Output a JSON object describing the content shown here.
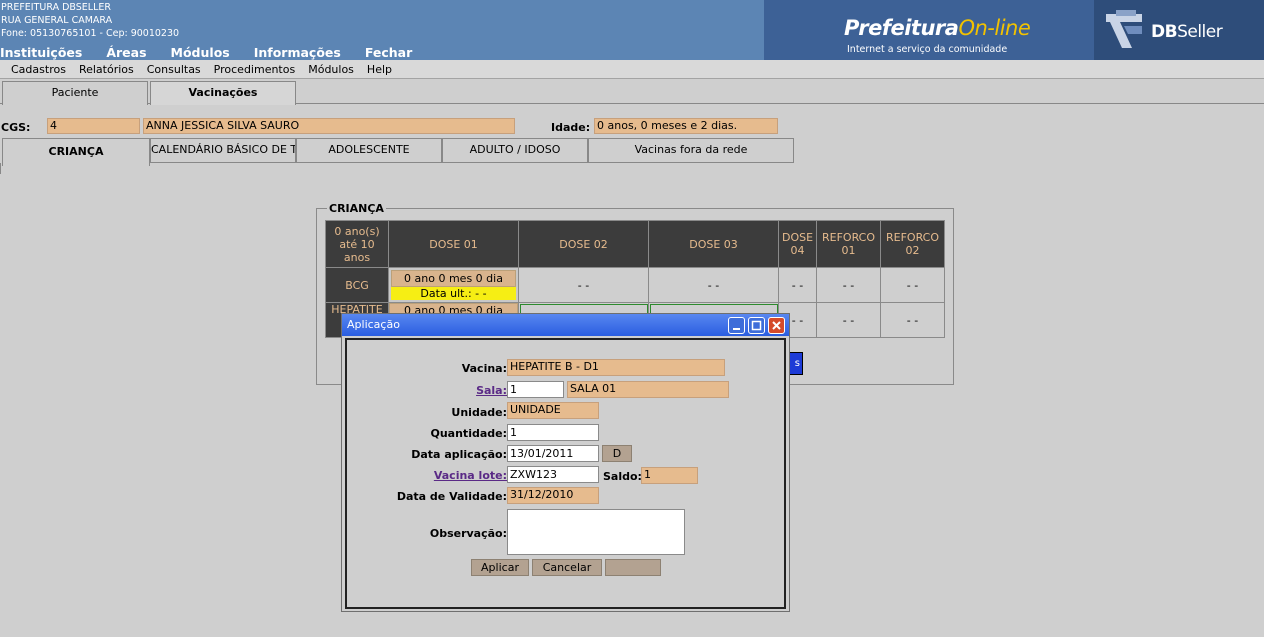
{
  "header": {
    "org_name": "PREFEITURA DBSELLER",
    "org_address": "RUA GENERAL CAMARA",
    "org_contact": "Fone: 05130765101  -  Cep: 90010230",
    "menu": [
      "Instituições",
      "Áreas",
      "Módulos",
      "Informações",
      "Fechar"
    ],
    "brand_main": "Prefeitura",
    "brand_online": "On-line",
    "brand_tagline": "Internet a serviço da comunidade",
    "dbseller_bold": "DB",
    "dbseller_rest": "Seller"
  },
  "submenu": [
    "Cadastros",
    "Relatórios",
    "Consultas",
    "Procedimentos",
    "Módulos",
    "Help"
  ],
  "tabs": {
    "paciente": "Paciente",
    "vacinacoes": "Vacinações"
  },
  "patient": {
    "cgs_label": "CGS:",
    "cgs_value": "4",
    "name": "ANNA JESSICA SILVA SAURO",
    "idade_label": "Idade:",
    "idade_value": "0 anos, 0 meses e 2 dias."
  },
  "age_tabs": [
    "CRIANÇA",
    "CALENDÁRIO BÁSICO DE T",
    "ADOLESCENTE",
    "ADULTO / IDOSO",
    "Vacinas fora da rede"
  ],
  "grid": {
    "legend": "CRIANÇA",
    "corner_1": "0 ano(s)",
    "corner_2": "até 10",
    "corner_3": "anos",
    "headers": [
      "DOSE 01",
      "DOSE 02",
      "DOSE 03"
    ],
    "dose04_a": "DOSE",
    "dose04_b": "04",
    "ref01_a": "REFORCO",
    "ref01_b": "01",
    "ref02_a": "REFORCO",
    "ref02_b": "02",
    "dash": "- -",
    "bcg": {
      "name": "BCG",
      "age": "0 ano  0 mes  0 dia",
      "last": "Data ult.: - -"
    },
    "hepatite": {
      "name": "HEPATITE",
      "age": "0 ano  0 mes  0 dia"
    },
    "blue_btn": "s"
  },
  "dialog": {
    "title": "Aplicação",
    "fields": {
      "vacina_label": "Vacina:",
      "vacina_value": "HEPATITE B - D1",
      "sala_label": "Sala:",
      "sala_code": "1",
      "sala_name": "SALA 01",
      "unidade_label": "Unidade:",
      "unidade_value": "UNIDADE",
      "quantidade_label": "Quantidade:",
      "quantidade_value": "1",
      "data_aplicacao_label": "Data aplicação:",
      "data_aplicacao_value": "13/01/2011",
      "date_btn": "D",
      "vacina_lote_label": "Vacina lote:",
      "vacina_lote_value": "ZXW123",
      "saldo_label": "Saldo:",
      "saldo_value": "1",
      "data_validade_label": "Data de Validade:",
      "data_validade_value": "31/12/2010",
      "observacao_label": "Observação:",
      "observacao_value": ""
    },
    "buttons": {
      "aplicar": "Aplicar",
      "cancelar": "Cancelar",
      "third": ""
    }
  },
  "colors": {
    "header_bg": "#5c85b4",
    "readonly_bg": "#e6bb8e",
    "grid_header_bg": "#3c3c3c",
    "title_bar": "#2a5de0",
    "highlight_yellow": "#f6ee14"
  }
}
